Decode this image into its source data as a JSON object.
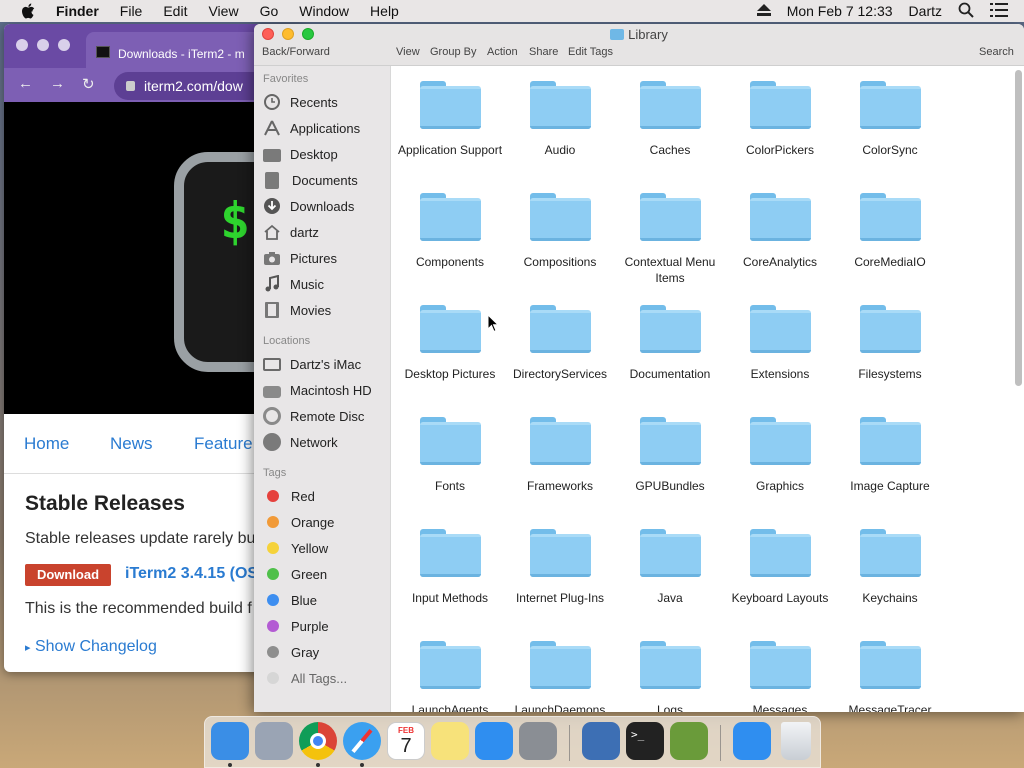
{
  "menubar": {
    "app_name": "Finder",
    "menus": [
      "File",
      "Edit",
      "View",
      "Go",
      "Window",
      "Help"
    ],
    "clock": "Mon Feb 7  12:33",
    "user": "Dartz"
  },
  "browser": {
    "tab_title": "Downloads - iTerm2 - m",
    "url": "iterm2.com/dow",
    "prompt": "$",
    "nav": [
      "Home",
      "News",
      "Feature"
    ],
    "heading": "Stable Releases",
    "desc": "Stable releases update rarely bu",
    "download_label": "Download",
    "release_link": "iTerm2 3.4.15 (OS",
    "recommended": "This is the recommended build f",
    "changelog": "Show Changelog"
  },
  "finder": {
    "title": "Library",
    "toolbar": {
      "back_forward": "Back/Forward",
      "view": "View",
      "group_by": "Group By",
      "action": "Action",
      "share": "Share",
      "edit_tags": "Edit Tags",
      "search": "Search"
    },
    "sidebar": {
      "favorites_heading": "Favorites",
      "favorites": [
        {
          "label": "Recents",
          "icon": "clock-icon"
        },
        {
          "label": "Applications",
          "icon": "applications-icon"
        },
        {
          "label": "Desktop",
          "icon": "desktop-icon"
        },
        {
          "label": "Documents",
          "icon": "document-icon"
        },
        {
          "label": "Downloads",
          "icon": "download-icon"
        },
        {
          "label": "dartz",
          "icon": "home-icon"
        },
        {
          "label": "Pictures",
          "icon": "camera-icon"
        },
        {
          "label": "Music",
          "icon": "music-icon"
        },
        {
          "label": "Movies",
          "icon": "film-icon"
        }
      ],
      "locations_heading": "Locations",
      "locations": [
        {
          "label": "Dartz's iMac",
          "icon": "imac-icon"
        },
        {
          "label": "Macintosh HD",
          "icon": "disk-icon"
        },
        {
          "label": "Remote Disc",
          "icon": "disc-icon"
        },
        {
          "label": "Network",
          "icon": "globe-icon"
        }
      ],
      "tags_heading": "Tags",
      "tags": [
        {
          "label": "Red",
          "color": "#e5413d"
        },
        {
          "label": "Orange",
          "color": "#f19a38"
        },
        {
          "label": "Yellow",
          "color": "#f5d23a"
        },
        {
          "label": "Green",
          "color": "#4fc04a"
        },
        {
          "label": "Blue",
          "color": "#3d8ef0"
        },
        {
          "label": "Purple",
          "color": "#b35bd3"
        },
        {
          "label": "Gray",
          "color": "#8e8e8e"
        },
        {
          "label": "All Tags...",
          "color": "#d6d6d6"
        }
      ]
    },
    "folders": [
      [
        "Application Support",
        "Audio",
        "Caches",
        "ColorPickers",
        "ColorSync"
      ],
      [
        "Components",
        "Compositions",
        "Contextual Menu Items",
        "CoreAnalytics",
        "CoreMediaIO"
      ],
      [
        "Desktop Pictures",
        "DirectoryServices",
        "Documentation",
        "Extensions",
        "Filesystems"
      ],
      [
        "Fonts",
        "Frameworks",
        "GPUBundles",
        "Graphics",
        "Image Capture"
      ],
      [
        "Input Methods",
        "Internet Plug-Ins",
        "Java",
        "Keyboard Layouts",
        "Keychains"
      ],
      [
        "LaunchAgents",
        "LaunchDaemons",
        "Logs",
        "Messages",
        "MessageTracer"
      ]
    ]
  },
  "dock": {
    "calendar_month": "FEB",
    "calendar_day": "7",
    "apps": [
      {
        "name": "finder-icon",
        "color": "#3a8ee6",
        "running": true
      },
      {
        "name": "launchpad-icon",
        "color": "#9aa4b4",
        "running": false
      },
      {
        "name": "chrome-icon",
        "color": "#e8e8e8",
        "running": true
      },
      {
        "name": "safari-icon",
        "color": "#3aa0f0",
        "running": true
      },
      {
        "name": "calendar-icon",
        "color": "#ffffff",
        "running": false
      },
      {
        "name": "notes-icon",
        "color": "#f7e27a",
        "running": false
      },
      {
        "name": "app-store-icon",
        "color": "#2f8ef0",
        "running": false
      },
      {
        "name": "system-preferences-icon",
        "color": "#8a8e94",
        "running": false
      },
      {
        "name": "virtualbox-icon",
        "color": "#3d6fb4",
        "running": false
      },
      {
        "name": "terminal-icon",
        "color": "#222222",
        "running": false
      },
      {
        "name": "minecraft-icon",
        "color": "#6a9b3a",
        "running": false
      },
      {
        "name": "app-store-download-icon",
        "color": "#2f8ef0",
        "running": false
      },
      {
        "name": "trash-icon",
        "color": "#d8dde2",
        "running": false
      }
    ]
  }
}
